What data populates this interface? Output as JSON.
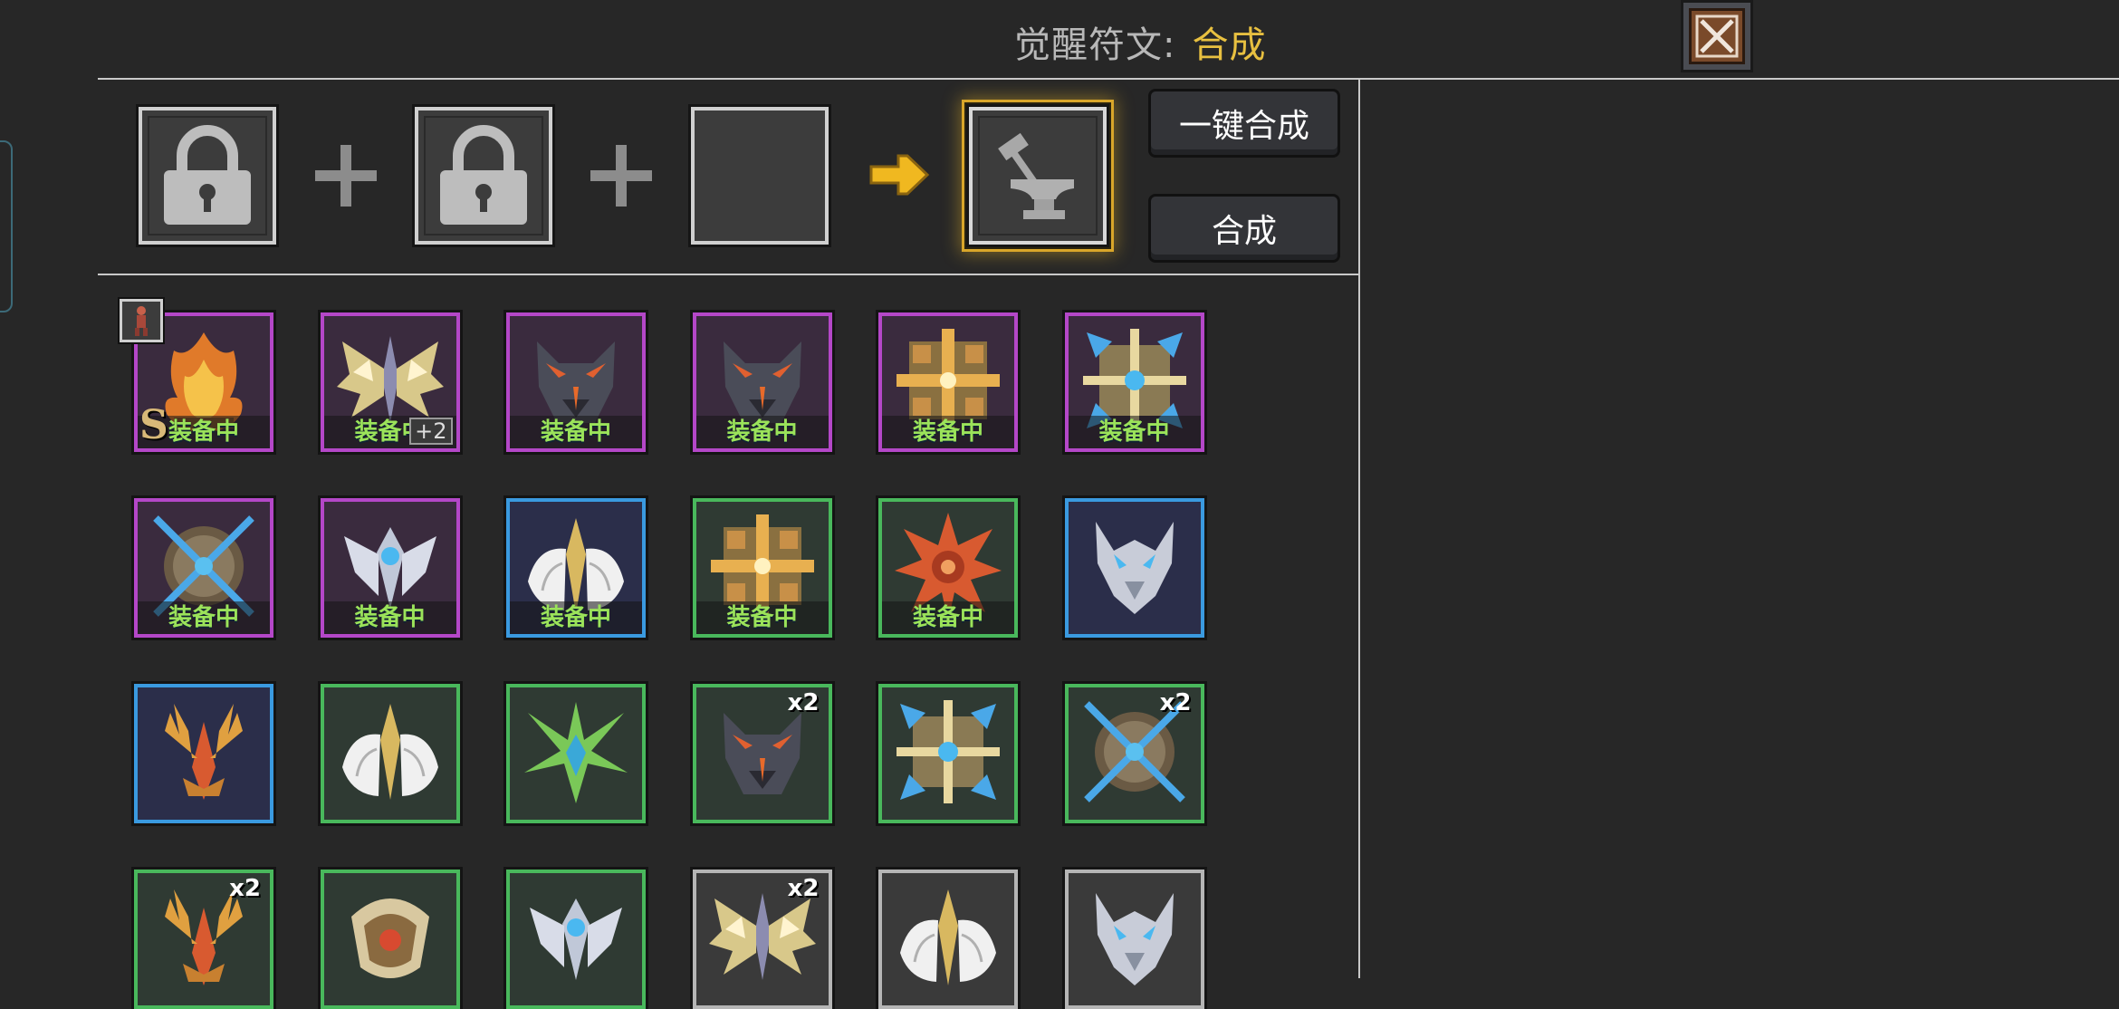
{
  "header": {
    "label": "觉醒符文:",
    "mode": "合成"
  },
  "buttons": {
    "one_click": "一键合成",
    "combine": "合成"
  },
  "equipped_text": "装备中",
  "runes": [
    {
      "color": "purple",
      "art": "flame",
      "equipped": true,
      "badge": "S"
    },
    {
      "color": "purple",
      "art": "wings-gold",
      "equipped": true,
      "count_bottom": "+2"
    },
    {
      "color": "purple",
      "art": "wolf",
      "equipped": true
    },
    {
      "color": "purple",
      "art": "wolf",
      "equipped": true
    },
    {
      "color": "purple",
      "art": "cross-gold",
      "equipped": true
    },
    {
      "color": "purple",
      "art": "cross-blue",
      "equipped": true
    },
    {
      "color": "purple",
      "art": "shield-orb",
      "equipped": true
    },
    {
      "color": "purple",
      "art": "crown-silver",
      "equipped": true
    },
    {
      "color": "blue",
      "art": "angel-wings",
      "equipped": true
    },
    {
      "color": "green",
      "art": "cross-gold",
      "equipped": true
    },
    {
      "color": "green",
      "art": "star-red",
      "equipped": true
    },
    {
      "color": "blue",
      "art": "dragon-silver",
      "equipped": false
    },
    {
      "color": "blue",
      "art": "antler-red",
      "equipped": false
    },
    {
      "color": "green",
      "art": "angel-wings",
      "equipped": false
    },
    {
      "color": "green",
      "art": "star-green",
      "equipped": false
    },
    {
      "color": "green",
      "art": "wolf",
      "equipped": false,
      "count": "x2"
    },
    {
      "color": "green",
      "art": "cross-blue",
      "equipped": false
    },
    {
      "color": "green",
      "art": "shield-orb",
      "equipped": false,
      "count": "x2"
    },
    {
      "color": "green",
      "art": "antler-red",
      "equipped": false,
      "count": "x2"
    },
    {
      "color": "green",
      "art": "crown-orb",
      "equipped": false
    },
    {
      "color": "green",
      "art": "crown-silver",
      "equipped": false
    },
    {
      "color": "gray",
      "art": "wings-gold",
      "equipped": false,
      "count": "x2"
    },
    {
      "color": "gray",
      "art": "angel-wings",
      "equipped": false
    },
    {
      "color": "gray",
      "art": "dragon-silver",
      "equipped": false
    }
  ]
}
